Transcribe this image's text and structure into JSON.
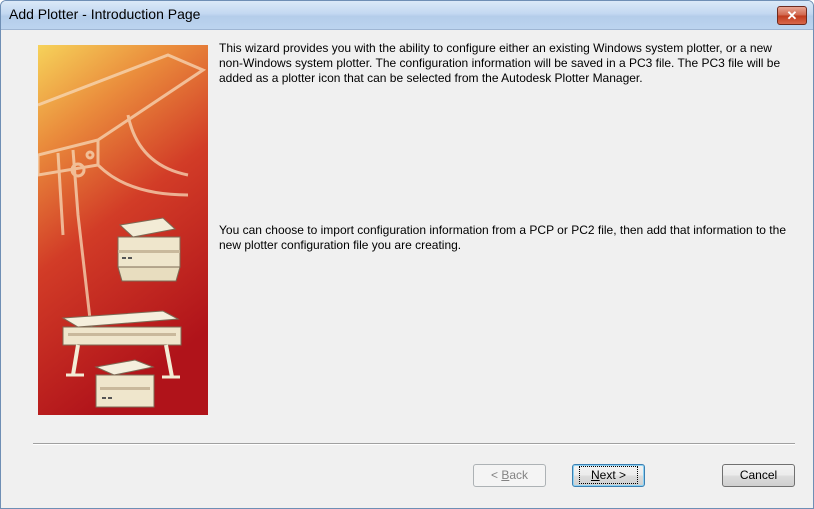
{
  "window": {
    "title": "Add Plotter - Introduction Page",
    "close_glyph": "✕"
  },
  "content": {
    "paragraph1": "This wizard provides you with the ability to configure either an existing Windows system plotter, or a new non-Windows system plotter. The configuration information will be saved in a PC3 file. The PC3 file will be added as a plotter icon that can be selected from the Autodesk Plotter Manager.",
    "paragraph2": "You can choose to import configuration information from a PCP or PC2 file, then add that information to the new plotter configuration file you are creating."
  },
  "buttons": {
    "back": {
      "prefix": "< ",
      "accel": "B",
      "rest": "ack"
    },
    "next": {
      "accel": "N",
      "rest": "ext >"
    },
    "cancel": "Cancel"
  },
  "colors": {
    "art_gradient_top": "#f6d25a",
    "art_gradient_mid": "#d8452a",
    "art_gradient_bottom": "#b0131a"
  },
  "icons": [
    "close-icon",
    "plotter-illustration"
  ]
}
